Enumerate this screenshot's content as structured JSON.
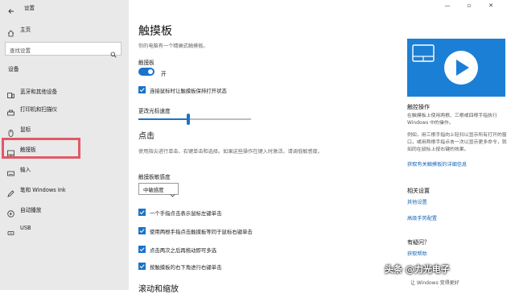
{
  "window": {
    "title": "设置",
    "controls": {
      "minimize": "—",
      "maximize": "▫",
      "close": "✕"
    }
  },
  "sidebar": {
    "home": "主页",
    "search_placeholder": "查找设置",
    "section": "设备",
    "items": [
      {
        "label": "蓝牙和其他设备",
        "icon": "bluetooth-icon"
      },
      {
        "label": "打印机和扫描仪",
        "icon": "printer-icon"
      },
      {
        "label": "鼠标",
        "icon": "mouse-icon"
      },
      {
        "label": "触摸板",
        "icon": "touchpad-icon",
        "selected": true
      },
      {
        "label": "输入",
        "icon": "keyboard-icon"
      },
      {
        "label": "笔和 Windows Ink",
        "icon": "pen-icon"
      },
      {
        "label": "自动播放",
        "icon": "autoplay-icon"
      },
      {
        "label": "USB",
        "icon": "usb-icon"
      }
    ]
  },
  "main": {
    "title": "触摸板",
    "subtitle": "你的电脑有一个精确式触摸板。",
    "touchpad_label": "触摸板",
    "toggle_state": "开",
    "toggle_on": true,
    "keep_on_label": "连接鼠标时让触摸板保持打开状态",
    "speed_label": "更改光标速度",
    "speed_value_fraction": 0.44,
    "tap_heading": "点击",
    "tap_desc": "使用指尖进行单击、右键单击和选择。如果这些操作在键入时激活，请调低敏感度。",
    "sensitivity_label": "触摸板敏感度",
    "sensitivity_value": "中敏感度",
    "options": [
      "一个手指点击表示鼠标左键单击",
      "使用两根手指点击触摸板等同于鼠标右键单击",
      "点击两次之后再拖动即可多选",
      "按触摸板的右下角进行右键单击"
    ],
    "next_heading": "滚动和缩放"
  },
  "right_pane": {
    "gesture_heading": "触控操作",
    "gesture_text": "在触摸板上使用两根、三根或四根手指执行 Windows 中的操作。",
    "gesture_text2": "例如，用三根手指向上轻扫以显示所有打开的窗口，或用两根手指点击一次以显示更多命令，就如同在鼠标上按右键的效果。",
    "gesture_link": "获取有关触摸板的详细信息",
    "related_heading": "相关设置",
    "related_links": [
      "其他设置",
      "高级手势配置"
    ],
    "question_heading": "有疑问？",
    "question_link": "获取帮助"
  },
  "watermark": {
    "main": "头条 @力光电子",
    "sub": "让 Windows 变得更好"
  },
  "colors": {
    "accent": "#1a73c9",
    "sidebar_bg": "#e9e9e9",
    "highlight": "#e05a67",
    "link": "#1565b8"
  }
}
